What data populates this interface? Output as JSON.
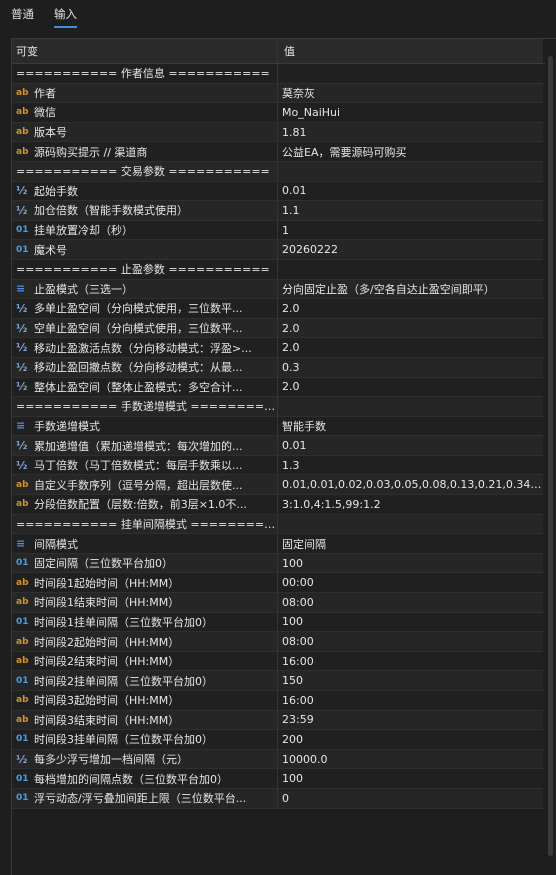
{
  "tabs": [
    {
      "label": "普通"
    },
    {
      "label": "输入"
    }
  ],
  "header": {
    "variable": "可变",
    "value": "值"
  },
  "rows": [
    {
      "type": "sep",
      "name": "=========== 作者信息 ===========",
      "value": ""
    },
    {
      "type": "ab",
      "name": "作者",
      "value": "莫奈灰"
    },
    {
      "type": "ab",
      "name": "微信",
      "value": "Mo_NaiHui"
    },
    {
      "type": "ab",
      "name": "版本号",
      "value": "1.81"
    },
    {
      "type": "ab",
      "name": "源码购买提示                    // 渠道商",
      "value": "公益EA，需要源码可购买"
    },
    {
      "type": "sep",
      "name": "=========== 交易参数 ===========",
      "value": ""
    },
    {
      "type": "half",
      "name": "起始手数",
      "value": "0.01"
    },
    {
      "type": "half",
      "name": "加仓倍数（智能手数模式使用）",
      "value": "1.1"
    },
    {
      "type": "num",
      "name": "挂单放置冷却（秒）",
      "value": "1"
    },
    {
      "type": "num",
      "name": "魔术号",
      "value": "20260222"
    },
    {
      "type": "sep",
      "name": "=========== 止盈参数 ===========",
      "value": ""
    },
    {
      "type": "enum",
      "name": "止盈模式（三选一）",
      "value": "分向固定止盈（多/空各自达止盈空间即平）"
    },
    {
      "type": "half",
      "name": "多单止盈空间（分向模式使用，三位数平...",
      "value": "2.0"
    },
    {
      "type": "half",
      "name": "空单止盈空间（分向模式使用，三位数平...",
      "value": "2.0"
    },
    {
      "type": "half",
      "name": "移动止盈激活点数（分向移动模式：浮盈>...",
      "value": "2.0"
    },
    {
      "type": "half",
      "name": "移动止盈回撤点数（分向移动模式：从最...",
      "value": "0.3"
    },
    {
      "type": "half",
      "name": "整体止盈空间（整体止盈模式：多空合计...",
      "value": "2.0"
    },
    {
      "type": "sep",
      "name": "=========== 手数递增模式 ==========...",
      "value": ""
    },
    {
      "type": "enum",
      "name": "手数递增模式",
      "value": "智能手数"
    },
    {
      "type": "half",
      "name": "累加递增值（累加递增模式：每次增加的...",
      "value": "0.01"
    },
    {
      "type": "half",
      "name": "马丁倍数（马丁倍数模式：每层手数乘以...",
      "value": "1.3"
    },
    {
      "type": "ab",
      "name": "自定义手数序列（逗号分隔，超出层数使...",
      "value": "0.01,0.01,0.02,0.03,0.05,0.08,0.13,0.21,0.34,..."
    },
    {
      "type": "ab",
      "name": "分段倍数配置（层数:倍数，前3层×1.0不...",
      "value": "3:1.0,4:1.5,99:1.2"
    },
    {
      "type": "sep",
      "name": "=========== 挂单间隔模式 ==========...",
      "value": ""
    },
    {
      "type": "enum",
      "name": "间隔模式",
      "value": "固定间隔"
    },
    {
      "type": "num",
      "name": "固定间隔（三位数平台加0）",
      "value": "100"
    },
    {
      "type": "ab",
      "name": "时间段1起始时间（HH:MM）",
      "value": "00:00"
    },
    {
      "type": "ab",
      "name": "时间段1结束时间（HH:MM）",
      "value": "08:00"
    },
    {
      "type": "num",
      "name": "时间段1挂单间隔（三位数平台加0）",
      "value": "100"
    },
    {
      "type": "ab",
      "name": "时间段2起始时间（HH:MM）",
      "value": "08:00"
    },
    {
      "type": "ab",
      "name": "时间段2结束时间（HH:MM）",
      "value": "16:00"
    },
    {
      "type": "num",
      "name": "时间段2挂单间隔（三位数平台加0）",
      "value": "150"
    },
    {
      "type": "ab",
      "name": "时间段3起始时间（HH:MM）",
      "value": "16:00"
    },
    {
      "type": "ab",
      "name": "时间段3结束时间（HH:MM）",
      "value": "23:59"
    },
    {
      "type": "num",
      "name": "时间段3挂单间隔（三位数平台加0）",
      "value": "200"
    },
    {
      "type": "half",
      "name": "每多少浮亏增加一档间隔（元）",
      "value": "10000.0"
    },
    {
      "type": "num",
      "name": "每档增加的间隔点数（三位数平台加0）",
      "value": "100"
    },
    {
      "type": "num",
      "name": "浮亏动态/浮亏叠加间距上限（三位数平台...",
      "value": "0"
    }
  ],
  "icons": {
    "ab": "ab",
    "half": "½",
    "num": "01",
    "enum": "≡"
  },
  "colors": {
    "accent": "#3f8fd8",
    "ab_icon": "#d4942a",
    "num_icon": "#4a9fe0"
  }
}
